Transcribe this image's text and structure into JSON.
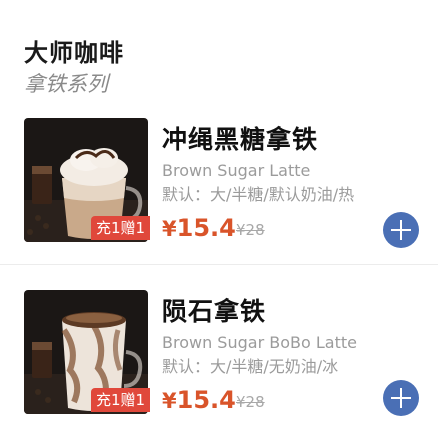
{
  "section": {
    "title": "大师咖啡",
    "subtitle": "拿铁系列"
  },
  "products": [
    {
      "name": "冲绳黑糖拿铁",
      "en_name": "Brown Sugar Latte",
      "options": "默认：大/半糖/默认奶油/热",
      "promo": "充1赠1",
      "price": "15.4",
      "currency": "¥",
      "original_price": "¥28",
      "image_icon": "brown-sugar-latte-photo",
      "add_icon": "plus-icon"
    },
    {
      "name": "陨石拿铁",
      "en_name": "Brown Sugar BoBo Latte",
      "options": "默认：大/半糖/无奶油/冰",
      "promo": "充1赠1",
      "price": "15.4",
      "currency": "¥",
      "original_price": "¥28",
      "image_icon": "bobo-latte-photo",
      "add_icon": "plus-icon"
    }
  ],
  "colors": {
    "price": "#d9542a",
    "promo_badge": "#e0483b",
    "add_button": "#4a6fb5",
    "secondary_text": "#9b9b9b"
  }
}
